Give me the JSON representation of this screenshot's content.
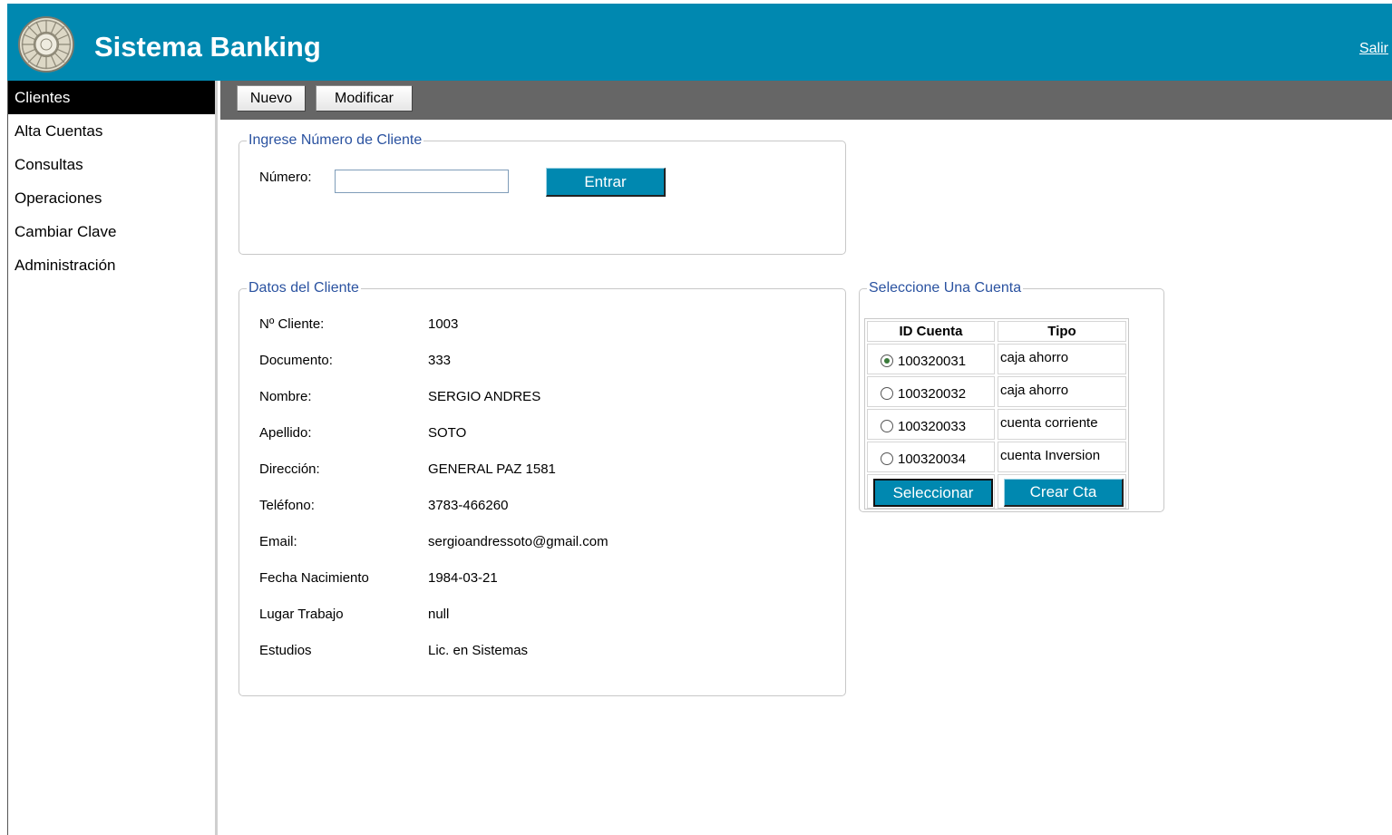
{
  "header": {
    "title": "Sistema Banking",
    "logout_label": "Salir",
    "logo_icon": "bank-seal-logo"
  },
  "colors": {
    "brand": "#0088b0",
    "toolbar": "#666666",
    "legend": "#2a52a0",
    "active_nav": "#000000"
  },
  "sidebar": {
    "items": [
      {
        "label": "Clientes",
        "active": true
      },
      {
        "label": "Alta Cuentas"
      },
      {
        "label": "Consultas"
      },
      {
        "label": "Operaciones"
      },
      {
        "label": "Cambiar Clave"
      },
      {
        "label": "Administración"
      }
    ]
  },
  "toolbar": {
    "new_label": "Nuevo",
    "modify_label": "Modificar"
  },
  "search": {
    "legend": "Ingrese Número de Cliente",
    "number_label": "Número:",
    "number_value": "",
    "enter_label": "Entrar"
  },
  "client": {
    "legend": "Datos del Cliente",
    "fields": [
      {
        "label": "Nº Cliente:",
        "value": "1003"
      },
      {
        "label": "Documento:",
        "value": "333"
      },
      {
        "label": "Nombre:",
        "value": "SERGIO ANDRES"
      },
      {
        "label": "Apellido:",
        "value": "SOTO"
      },
      {
        "label": "Dirección:",
        "value": "GENERAL PAZ 1581"
      },
      {
        "label": "Teléfono:",
        "value": "3783-466260"
      },
      {
        "label": "Email:",
        "value": "sergioandressoto@gmail.com"
      },
      {
        "label": "Fecha Nacimiento",
        "value": "1984-03-21"
      },
      {
        "label": "Lugar Trabajo",
        "value": "null"
      },
      {
        "label": "Estudios",
        "value": "Lic. en Sistemas"
      }
    ]
  },
  "accounts": {
    "legend": "Seleccione Una Cuenta",
    "headers": [
      "ID Cuenta",
      "Tipo"
    ],
    "rows": [
      {
        "id": "100320031",
        "type": "caja ahorro",
        "selected": true
      },
      {
        "id": "100320032",
        "type": "caja ahorro",
        "selected": false
      },
      {
        "id": "100320033",
        "type": "cuenta corriente",
        "selected": false
      },
      {
        "id": "100320034",
        "type": "cuenta Inversion",
        "selected": false
      }
    ],
    "select_label": "Seleccionar",
    "create_label": "Crear Cta"
  }
}
